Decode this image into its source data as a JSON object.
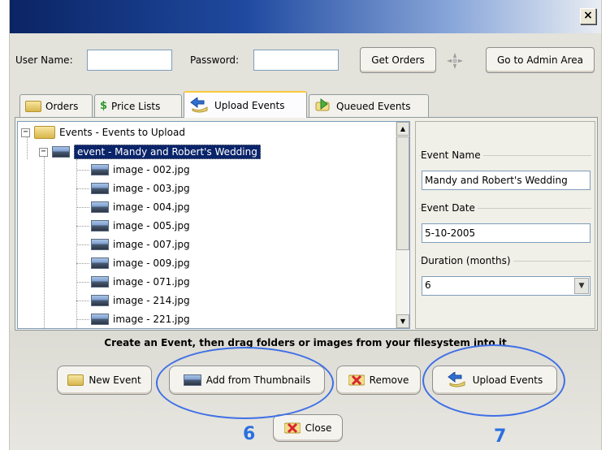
{
  "login": {
    "username_label": "User Name:",
    "username_value": "",
    "password_label": "Password:",
    "password_value": "",
    "get_orders": "Get Orders",
    "admin": "Go to Admin Area"
  },
  "tabs": [
    {
      "label": "Orders",
      "icon": "folder-icon"
    },
    {
      "label": "Price Lists",
      "icon": "dollar-icon"
    },
    {
      "label": "Upload Events",
      "icon": "upload-arrow-icon"
    },
    {
      "label": "Queued Events",
      "icon": "queue-arrow-icon"
    }
  ],
  "tree": {
    "root_label": "Events -  Events to Upload",
    "event_label": "event -  Mandy and Robert's Wedding",
    "images": [
      "image -  002.jpg",
      "image -  003.jpg",
      "image -  004.jpg",
      "image -  005.jpg",
      "image -  007.jpg",
      "image -  009.jpg",
      "image -  071.jpg",
      "image -  214.jpg",
      "image -  221.jpg"
    ]
  },
  "props": {
    "event_name_label": "Event Name",
    "event_name_value": "Mandy and Robert's Wedding",
    "event_date_label": "Event Date",
    "event_date_value": "5-10-2005",
    "duration_label": "Duration (months)",
    "duration_value": "6"
  },
  "instruction": "Create an Event, then drag folders or images from your filesystem into it",
  "actions": {
    "new_event": "New Event",
    "add_thumbs": "Add from Thumbnails",
    "remove": "Remove",
    "upload": "Upload Events",
    "close": "Close"
  },
  "callouts": [
    "6",
    "7"
  ],
  "colors": {
    "accent_circle": "#3f6fe6",
    "callout_number": "#2a6fe0",
    "selection": "#0a246a"
  }
}
